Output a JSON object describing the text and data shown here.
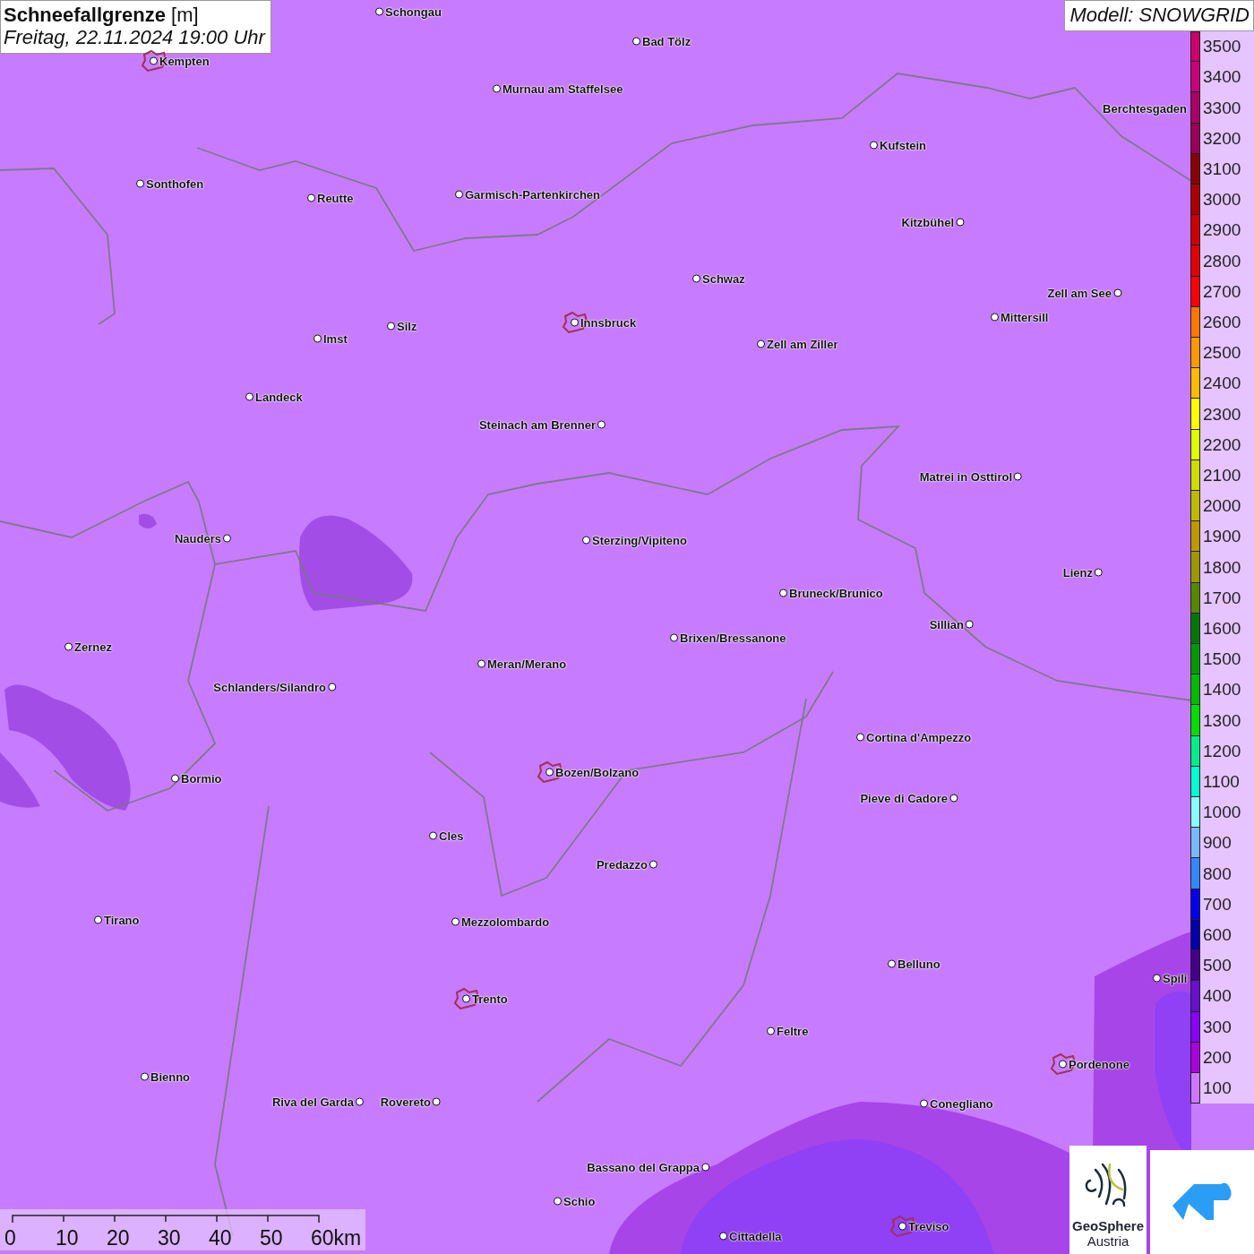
{
  "title": {
    "heading": "**Schneefallgrenze** [m]",
    "time": "Freitag, 22.11.2024 19:00 Uhr"
  },
  "model": "Modell: SNOWGRID",
  "legend": [
    {
      "label": "3500",
      "color": "#cc0066"
    },
    {
      "label": "3400",
      "color": "#c8007a"
    },
    {
      "label": "3300",
      "color": "#aa0066"
    },
    {
      "label": "3200",
      "color": "#990055"
    },
    {
      "label": "3100",
      "color": "#880000"
    },
    {
      "label": "3000",
      "color": "#aa0000"
    },
    {
      "label": "2900",
      "color": "#cc0000"
    },
    {
      "label": "2800",
      "color": "#e00000"
    },
    {
      "label": "2700",
      "color": "#ff0000"
    },
    {
      "label": "2600",
      "color": "#ff7700"
    },
    {
      "label": "2500",
      "color": "#ff9900"
    },
    {
      "label": "2400",
      "color": "#ffbb00"
    },
    {
      "label": "2300",
      "color": "#ffff00"
    },
    {
      "label": "2200",
      "color": "#ddff00"
    },
    {
      "label": "2100",
      "color": "#ccdd00"
    },
    {
      "label": "2000",
      "color": "#bbbb00"
    },
    {
      "label": "1900",
      "color": "#bb9900"
    },
    {
      "label": "1800",
      "color": "#999900"
    },
    {
      "label": "1700",
      "color": "#558800"
    },
    {
      "label": "1600",
      "color": "#007700"
    },
    {
      "label": "1500",
      "color": "#009900"
    },
    {
      "label": "1400",
      "color": "#00bb00"
    },
    {
      "label": "1300",
      "color": "#00dd00"
    },
    {
      "label": "1200",
      "color": "#00ee88"
    },
    {
      "label": "1100",
      "color": "#00ffcc"
    },
    {
      "label": "1000",
      "color": "#88ffff"
    },
    {
      "label": "900",
      "color": "#77bbff"
    },
    {
      "label": "800",
      "color": "#3388ff"
    },
    {
      "label": "700",
      "color": "#0000ee"
    },
    {
      "label": "600",
      "color": "#0000aa"
    },
    {
      "label": "500",
      "color": "#440088"
    },
    {
      "label": "400",
      "color": "#6611cc"
    },
    {
      "label": "300",
      "color": "#8800ff"
    },
    {
      "label": "200",
      "color": "#aa00dd"
    },
    {
      "label": "100",
      "color": "#cc77ff"
    }
  ],
  "cities": [
    {
      "name": "Schongau",
      "boundary": false
    },
    {
      "name": "Bad Tölz",
      "boundary": false
    },
    {
      "name": "Kempten",
      "boundary": true
    },
    {
      "name": "Murnau am Staffelsee",
      "boundary": false
    },
    {
      "name": "Berchtesgaden",
      "boundary": false
    },
    {
      "name": "Kufstein",
      "boundary": false
    },
    {
      "name": "Sonthofen",
      "boundary": false
    },
    {
      "name": "Reutte",
      "boundary": false
    },
    {
      "name": "Garmisch-Partenkirchen",
      "boundary": false
    },
    {
      "name": "Kitzbühel",
      "boundary": false
    },
    {
      "name": "Schwaz",
      "boundary": false
    },
    {
      "name": "Zell am See",
      "boundary": false
    },
    {
      "name": "Mittersill",
      "boundary": false
    },
    {
      "name": "Innsbruck",
      "boundary": true
    },
    {
      "name": "Silz",
      "boundary": false
    },
    {
      "name": "Imst",
      "boundary": false
    },
    {
      "name": "Zell am Ziller",
      "boundary": false
    },
    {
      "name": "Landeck",
      "boundary": false
    },
    {
      "name": "Steinach am Brenner",
      "boundary": false
    },
    {
      "name": "Matrei in Osttirol",
      "boundary": false
    },
    {
      "name": "Nauders",
      "boundary": false
    },
    {
      "name": "Sterzing/Vipiteno",
      "boundary": false
    },
    {
      "name": "Lienz",
      "boundary": false
    },
    {
      "name": "Bruneck/Brunico",
      "boundary": false
    },
    {
      "name": "Sillian",
      "boundary": false
    },
    {
      "name": "Brixen/Bressanone",
      "boundary": false
    },
    {
      "name": "Zernez",
      "boundary": false
    },
    {
      "name": "Meran/Merano",
      "boundary": false
    },
    {
      "name": "Schlanders/Silandro",
      "boundary": false
    },
    {
      "name": "Cortina d'Ampezzo",
      "boundary": false
    },
    {
      "name": "Bozen/Bolzano",
      "boundary": true
    },
    {
      "name": "Bormio",
      "boundary": false
    },
    {
      "name": "Pieve di Cadore",
      "boundary": false
    },
    {
      "name": "Cles",
      "boundary": false
    },
    {
      "name": "Predazzo",
      "boundary": false
    },
    {
      "name": "Tirano",
      "boundary": false
    },
    {
      "name": "Mezzolombardo",
      "boundary": false
    },
    {
      "name": "Belluno",
      "boundary": false
    },
    {
      "name": "Spili",
      "boundary": false
    },
    {
      "name": "Trento",
      "boundary": true
    },
    {
      "name": "Feltre",
      "boundary": false
    },
    {
      "name": "Pordenone",
      "boundary": true
    },
    {
      "name": "Bienno",
      "boundary": false
    },
    {
      "name": "Riva del Garda",
      "boundary": false
    },
    {
      "name": "Rovereto",
      "boundary": false
    },
    {
      "name": "Conegliano",
      "boundary": false
    },
    {
      "name": "Bassano del Grappa",
      "boundary": false
    },
    {
      "name": "Schio",
      "boundary": false
    },
    {
      "name": "Cittadella",
      "boundary": false
    },
    {
      "name": "Treviso",
      "boundary": true
    }
  ],
  "scale": {
    "ticks": [
      "0",
      "10",
      "20",
      "30",
      "40",
      "50",
      "60km"
    ]
  },
  "logo": {
    "name": "GeoSphere",
    "country": "Austria"
  }
}
